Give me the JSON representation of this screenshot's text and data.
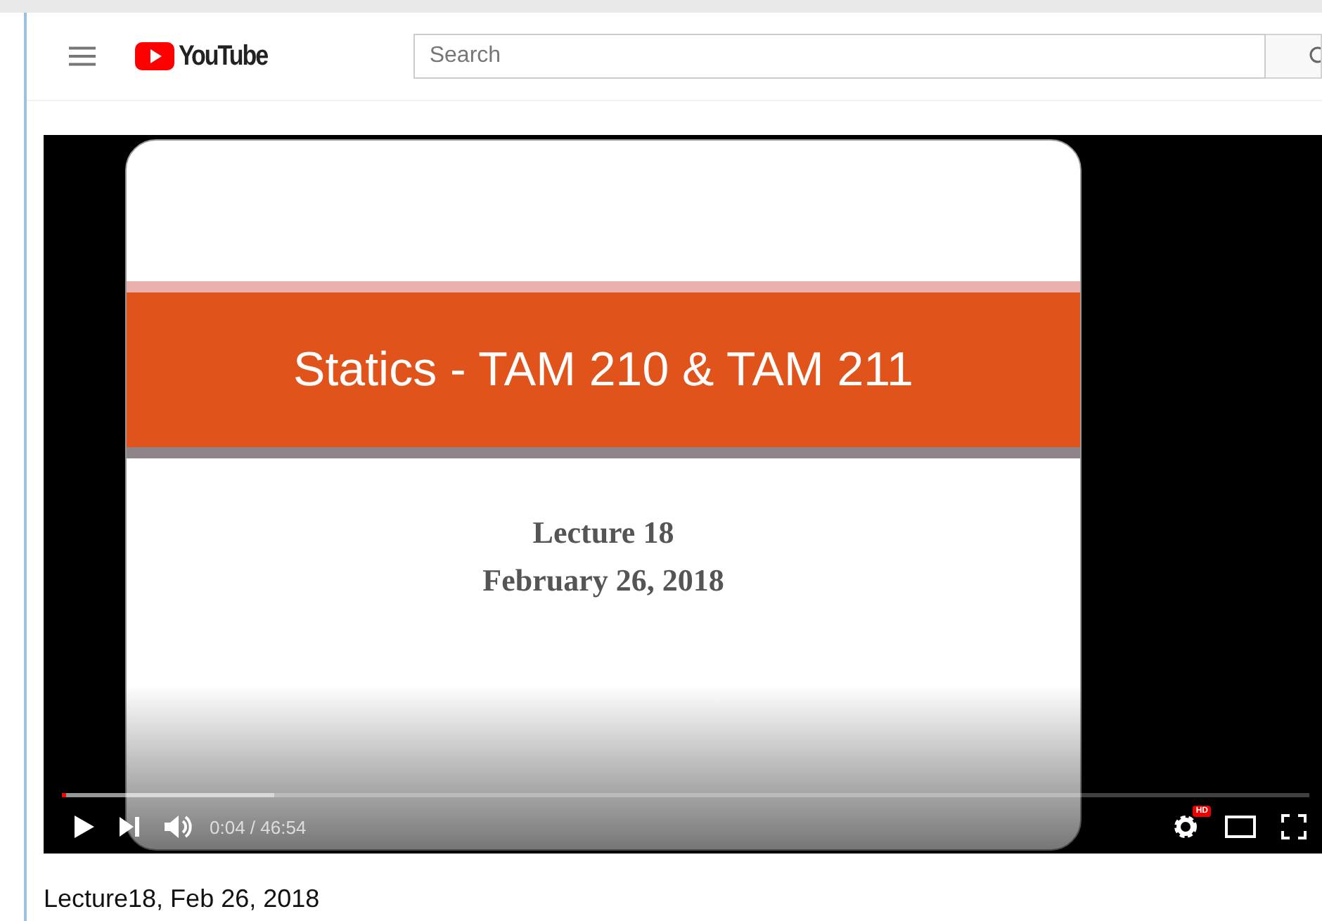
{
  "header": {
    "logo": "YouTube",
    "search": {
      "placeholder": "Search"
    }
  },
  "player": {
    "slide": {
      "title": "Statics - TAM 210 & TAM 211",
      "lines": [
        "Lecture 18",
        "February 26, 2018"
      ]
    },
    "progress": {
      "level": 0.003
    },
    "time": "0:04 / 46:54",
    "quality_badge": "HD"
  },
  "video_title": "Lecture18, Feb 26, 2018"
}
